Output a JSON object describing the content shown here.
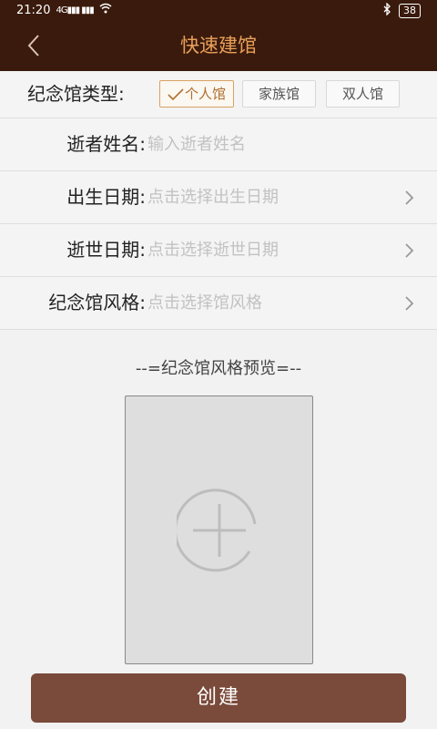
{
  "status_bar": {
    "time": "21:20",
    "signal_text": "4G",
    "bluetooth_icon": "bluetooth-icon",
    "battery": "38"
  },
  "header": {
    "title": "快速建馆",
    "back_icon": "chevron-left-icon"
  },
  "memorial_type": {
    "label": "纪念馆类型:",
    "options": [
      "个人馆",
      "家族馆",
      "双人馆"
    ],
    "selected": "个人馆"
  },
  "fields": [
    {
      "label": "逝者姓名:",
      "placeholder": "输入逝者姓名",
      "has_chevron": false
    },
    {
      "label": "出生日期:",
      "placeholder": "点击选择出生日期",
      "has_chevron": true
    },
    {
      "label": "逝世日期:",
      "placeholder": "点击选择逝世日期",
      "has_chevron": true
    },
    {
      "label": "纪念馆风格:",
      "placeholder": "点击选择馆风格",
      "has_chevron": true
    }
  ],
  "preview": {
    "title": "--=纪念馆风格预览=--",
    "icon": "add-circle-icon"
  },
  "create_button": "创建",
  "colors": {
    "header_bg": "#3a1a0c",
    "title": "#e9a05a",
    "accent": "#d9a262",
    "button": "#7a4a3a"
  }
}
